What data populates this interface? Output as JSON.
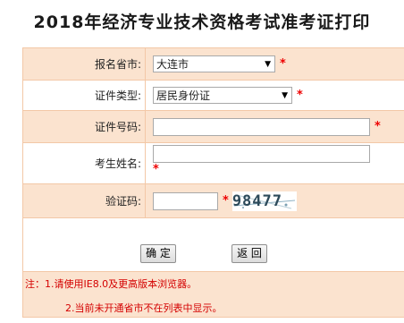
{
  "page": {
    "title": "2018年经济专业技术资格考试准考证打印"
  },
  "form": {
    "province": {
      "label": "报名省市:",
      "value": "大连市"
    },
    "id_type": {
      "label": "证件类型:",
      "value": "居民身份证"
    },
    "id_number": {
      "label": "证件号码:",
      "value": ""
    },
    "name": {
      "label": "考生姓名:",
      "value": ""
    },
    "captcha": {
      "label": "验证码:",
      "value": "",
      "image_text": "98477"
    },
    "required_mark": "*"
  },
  "buttons": {
    "confirm": "确 定",
    "back": "返 回"
  },
  "notes": {
    "line1": "注：1.请使用IE8.0及更高版本浏览器。",
    "line2": "2.当前未开通省市不在列表中显示。"
  },
  "colors": {
    "row_tint": "#fbe3cf",
    "border": "#f3c8a7",
    "required": "#ee0000",
    "note": "#d40000"
  }
}
